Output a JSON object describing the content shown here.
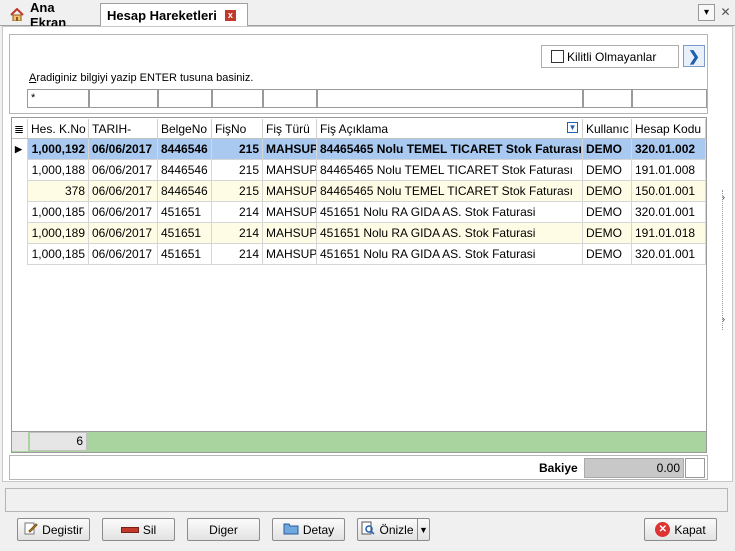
{
  "tabs": {
    "home_label": "Ana Ekran",
    "active_label": "Hesap Hareketleri",
    "close_glyph": "x",
    "menu_glyph": "v",
    "window_close_glyph": "x"
  },
  "filter": {
    "kilitli_label": "Kilitli Olmayanlar",
    "next_glyph": ">",
    "hint_first": "A",
    "hint_rest": "radiginiz bilgiyi yazip ENTER tusuna basiniz.",
    "first_cell_value": "*"
  },
  "grid": {
    "columns": [
      "Hes. K.No",
      "TARIH-",
      "BelgeNo",
      "FişNo",
      "Fiş Türü",
      "Fiş Açıklama",
      "Kullanıc",
      "Hesap Kodu"
    ],
    "rows": [
      [
        "1,000,192",
        "06/06/2017",
        "8446546",
        "215",
        "MAHSUP",
        "84465465 Nolu TEMEL TICARET Stok Faturası",
        "DEMO",
        "320.01.002"
      ],
      [
        "1,000,188",
        "06/06/2017",
        "8446546",
        "215",
        "MAHSUP",
        "84465465 Nolu TEMEL TICARET Stok Faturası",
        "DEMO",
        "191.01.008"
      ],
      [
        "378",
        "06/06/2017",
        "8446546",
        "215",
        "MAHSUP",
        "84465465 Nolu TEMEL TICARET Stok Faturası",
        "DEMO",
        "150.01.001"
      ],
      [
        "1,000,185",
        "06/06/2017",
        "451651",
        "214",
        "MAHSUP",
        "451651 Nolu RA GIDA AS. Stok Faturasi",
        "DEMO",
        "320.01.001"
      ],
      [
        "1,000,189",
        "06/06/2017",
        "451651",
        "214",
        "MAHSUP",
        "451651 Nolu RA GIDA AS. Stok Faturasi",
        "DEMO",
        "191.01.018"
      ],
      [
        "1,000,185",
        "06/06/2017",
        "451651",
        "214",
        "MAHSUP",
        "451651 Nolu RA GIDA AS. Stok Faturasi",
        "DEMO",
        "320.01.001"
      ]
    ],
    "row_count": "6"
  },
  "bakiye": {
    "label": "Bakiye",
    "value": "0.00"
  },
  "buttons": {
    "degistir": "Degistir",
    "sil": "Sil",
    "diger": "Diger",
    "detay": "Detay",
    "onizle": "Önizle",
    "kapat": "Kapat"
  },
  "colors": {
    "selected_row": "#a9c9f0",
    "alt_row": "#fefce5",
    "footer_green": "#a9d4a0"
  }
}
